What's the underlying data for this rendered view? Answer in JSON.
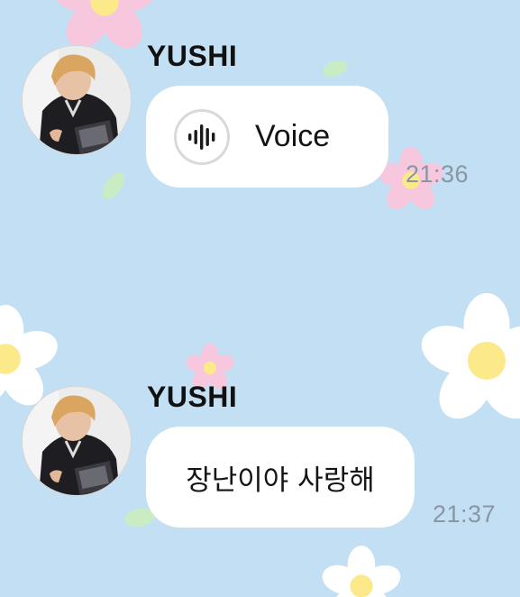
{
  "colors": {
    "wallpaper": "#c3dff3",
    "bubble": "#ffffff",
    "timestamp": "#8a97a3",
    "flower_petal_white": "#ffffff",
    "flower_petal_pink": "#f7c7de",
    "flower_center": "#fbe98a",
    "leaf": "#c9ecc4"
  },
  "messages": [
    {
      "sender": "YUSHI",
      "type": "voice",
      "icon": "voice-waveform-icon",
      "label": "Voice",
      "time": "21:36"
    },
    {
      "sender": "YUSHI",
      "type": "text",
      "text": "장난이야 사랑해",
      "time": "21:37"
    }
  ]
}
